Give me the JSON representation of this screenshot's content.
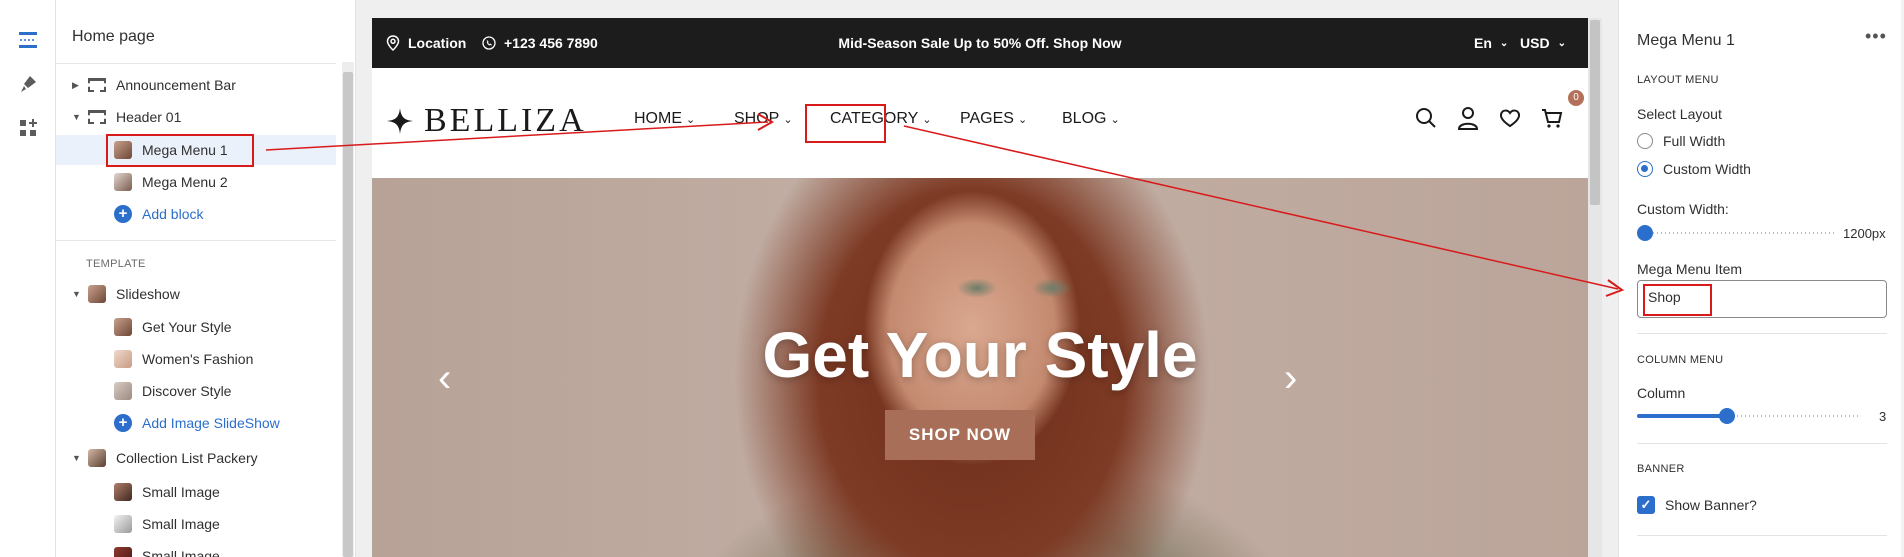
{
  "rail": {
    "icons": [
      "sections-icon",
      "brush-icon",
      "apps-icon"
    ]
  },
  "sidebar": {
    "title": "Home page",
    "header_group": {
      "announcement_bar": "Announcement Bar",
      "header": "Header 01",
      "children": [
        "Mega Menu 1",
        "Mega Menu 2"
      ],
      "add_block": "Add block"
    },
    "template_label": "TEMPLATE",
    "slideshow": {
      "label": "Slideshow",
      "children": [
        "Get Your Style",
        "Women's Fashion",
        "Discover Style"
      ],
      "add": "Add Image SlideShow"
    },
    "collection": {
      "label": "Collection List Packery",
      "children": [
        "Small Image",
        "Small Image",
        "Small Image"
      ]
    }
  },
  "preview": {
    "announcement": {
      "location": "Location",
      "phone": "+123 456 7890",
      "promo": "Mid-Season Sale Up to 50% Off. Shop Now",
      "language": "En",
      "currency": "USD"
    },
    "logo_text": "BELLIZA",
    "nav": [
      "HOME",
      "SHOP",
      "CATEGORY",
      "PAGES",
      "BLOG"
    ],
    "cart_count": "0",
    "hero": {
      "title": "Get Your Style",
      "button": "SHOP NOW"
    }
  },
  "panel": {
    "title": "Mega Menu 1",
    "more": "•••",
    "layout_section": "LAYOUT MENU",
    "select_layout_label": "Select Layout",
    "layout_options": [
      "Full Width",
      "Custom Width"
    ],
    "layout_selected": "Custom Width",
    "custom_width_label": "Custom Width:",
    "custom_width_value": "1200px",
    "custom_width_level": 0.0,
    "mega_item_label": "Mega Menu Item",
    "mega_item_value": "Shop",
    "column_section": "COLUMN MENU",
    "column_label": "Column",
    "column_value": "3",
    "column_level": 0.4,
    "banner_section": "BANNER",
    "show_banner_label": "Show Banner?",
    "show_banner_checked": true
  },
  "colors": {
    "accent_blue": "#2c6ecb",
    "annotation_red": "#d81a1a",
    "announcement_bg": "#1c1c1c",
    "hero_button": "#a86e58"
  }
}
